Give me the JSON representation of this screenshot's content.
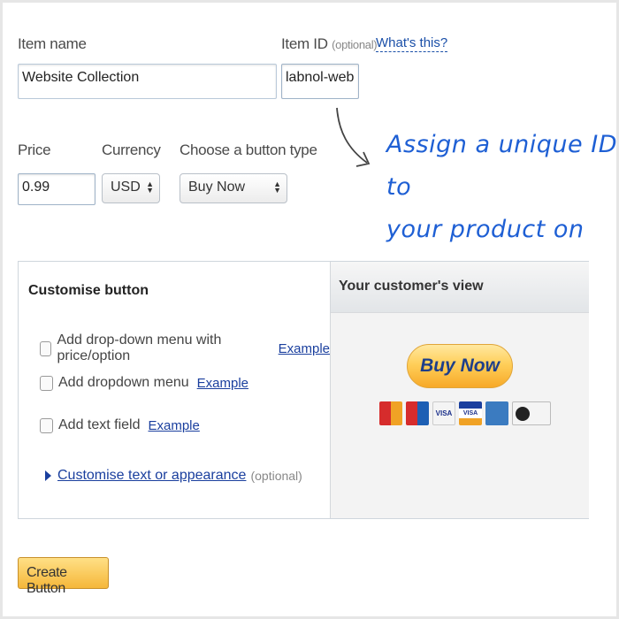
{
  "form": {
    "item_name_label": "Item name",
    "item_name_value": "Website Collection",
    "item_id_label": "Item ID",
    "item_id_optional": "(optional)",
    "whats_this": "What's this?",
    "item_id_value": "labnol-web",
    "price_label": "Price",
    "price_value": "0.99",
    "currency_label": "Currency",
    "currency_value": "USD",
    "button_type_label": "Choose a button type",
    "button_type_value": "Buy Now"
  },
  "annotation": {
    "line1": "Assign a unique ID to",
    "line2": "your product on PayPal"
  },
  "customise": {
    "title": "Customise button",
    "options": [
      {
        "label": "Add drop-down menu with price/option",
        "link": "Example"
      },
      {
        "label": "Add dropdown menu",
        "link": "Example"
      },
      {
        "label": "Add text field",
        "link": "Example"
      }
    ],
    "appearance_link": "Customise text or appearance",
    "appearance_optional": "(optional)"
  },
  "preview": {
    "title": "Your customer's view",
    "button_label": "Buy Now",
    "card_icons": [
      "mastercard-icon",
      "maestro-icon",
      "visa-icon",
      "visa-electron-icon",
      "amex-icon",
      "discover-icon"
    ]
  },
  "actions": {
    "create_button": "Create Button"
  },
  "colors": {
    "link": "#1a3f9e",
    "annotation": "#1e5fd4",
    "button_gold": "#f7b733"
  }
}
